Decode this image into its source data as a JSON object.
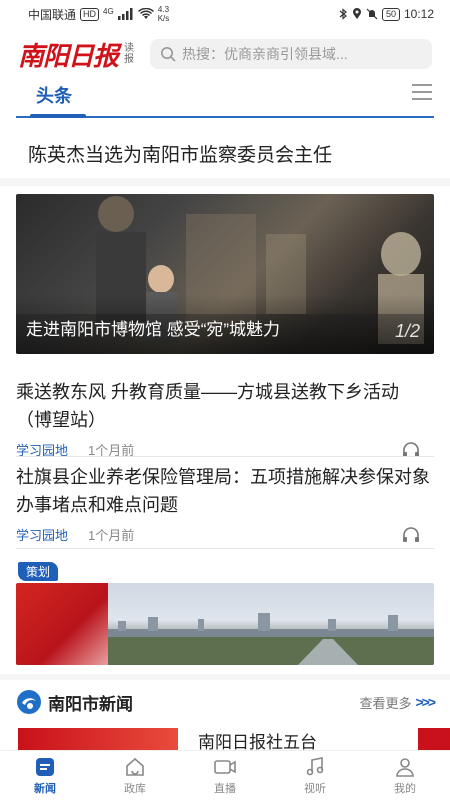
{
  "status_bar": {
    "carrier": "中国联通",
    "hd": "HD",
    "signal_type": "4G",
    "speed_value": "4.3",
    "speed_unit": "K/s",
    "battery": "50",
    "time": "10:12"
  },
  "header": {
    "logo": "南阳日报",
    "logo_sub": "读报",
    "search_placeholder": "热搜：优商亲商引领县域..."
  },
  "tabs": {
    "active": "头条"
  },
  "headline": "陈英杰当选为南阳市监察委员会主任",
  "carousel": {
    "caption": "走进南阳市博物馆 感受“宛”城魅力",
    "index": "1/2"
  },
  "articles": [
    {
      "title": "乘送教东风 升教育质量——方城县送教下乡活动（博望站）",
      "source": "学习园地",
      "time": "1个月前"
    },
    {
      "title": "社旗县企业养老保险管理局：五项措施解决参保对象办事堵点和难点问题",
      "source": "学习园地",
      "time": "1个月前"
    }
  ],
  "planning_tag": "策划",
  "section": {
    "title": "南阳市新闻",
    "see_more": "查看更多",
    "preview_title": "南阳日报社五台"
  },
  "bottom_nav": [
    {
      "label": "新闻",
      "icon": "news-icon",
      "active": true
    },
    {
      "label": "政库",
      "icon": "home-icon",
      "active": false
    },
    {
      "label": "直播",
      "icon": "video-icon",
      "active": false
    },
    {
      "label": "视听",
      "icon": "music-icon",
      "active": false
    },
    {
      "label": "我的",
      "icon": "user-icon",
      "active": false
    }
  ],
  "colors": {
    "brand_red": "#d0121b",
    "accent_blue": "#1f5fb8"
  }
}
